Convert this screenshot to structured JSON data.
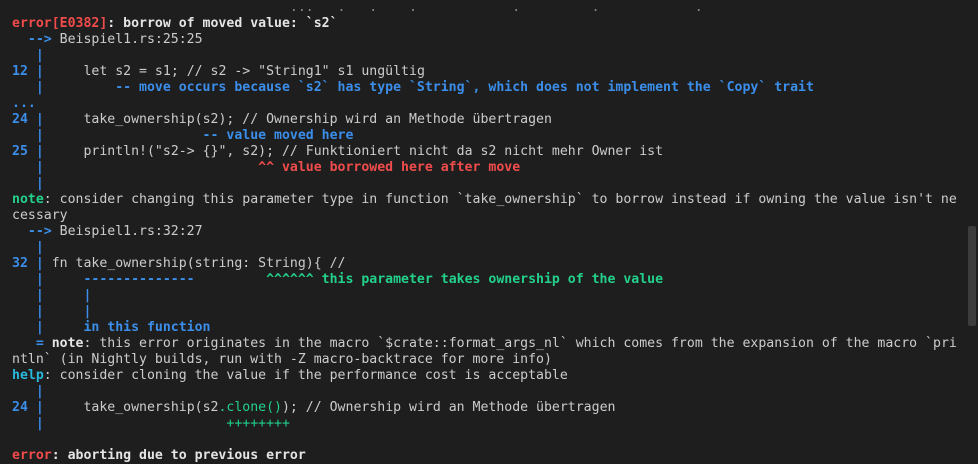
{
  "terminal": {
    "top_partial": "                                   ...   .   .    .            .         .            .  ",
    "error_head": {
      "kind": "error[E0382]",
      "msg": ": borrow of moved value: `s2`"
    },
    "loc1": {
      "arrow": "  --> ",
      "path": "Beispiel1.rs:25:25"
    },
    "gutter_bar": "   |",
    "l12": {
      "num": "12 ",
      "bar": "|",
      "code": "     let s2 = s1; // s2 -> \"String1\" s1 ungültig"
    },
    "l12_note": {
      "bar": "   |",
      "text": "         -- move occurs because `s2` has type `String`, which does not implement the `Copy` trait"
    },
    "ellipsis": "...",
    "l24": {
      "num": "24 ",
      "bar": "|",
      "code": "     take_ownership(s2); // Ownership wird an Methode übertragen"
    },
    "l24_note": {
      "bar": "   |",
      "text": "                    -- value moved here"
    },
    "l25": {
      "num": "25 ",
      "bar": "|",
      "code": "     println!(\"s2-> {}\", s2); // Funktioniert nicht da s2 nicht mehr Owner ist"
    },
    "l25_note": {
      "bar": "   |",
      "text": "                           ^^ value borrowed here after move"
    },
    "note1_a": {
      "label": "note",
      "text": ": consider changing this parameter type in function `take_ownership` to borrow instead if owning the value isn't ne"
    },
    "note1_b": "cessary",
    "loc2": {
      "arrow": "  --> ",
      "path": "Beispiel1.rs:32:27"
    },
    "l32": {
      "num": "32 ",
      "bar": "|",
      "code": " fn take_ownership(string: String){ //"
    },
    "l32_note1": {
      "bar": "   |",
      "dashes": "     --------------         ",
      "carets": "^^^^^^ this parameter takes ownership of the value"
    },
    "l32_note2": {
      "bar": "   |",
      "text": "     |"
    },
    "l32_note3": {
      "bar": "   |",
      "text": "     |"
    },
    "l32_note4": {
      "bar": "   |",
      "text": "     in this function"
    },
    "note2_a": {
      "eq": "   = ",
      "label": "note",
      "text": ": this error originates in the macro `$crate::format_args_nl` which comes from the expansion of the macro `pri"
    },
    "note2_b": "ntln` (in Nightly builds, run with -Z macro-backtrace for more info)",
    "help": {
      "label": "help",
      "text": ": consider cloning the value if the performance cost is acceptable"
    },
    "l24b": {
      "num": "24 ",
      "bar": "|",
      "code_a": "     take_ownership(s2",
      "code_b": ".clone()",
      "code_c": "); // Ownership wird an Methode übertragen"
    },
    "l24b_note": {
      "bar": "   |",
      "text": "                       ++++++++"
    },
    "final": {
      "label": "error",
      "text": ": aborting due to previous error"
    }
  }
}
